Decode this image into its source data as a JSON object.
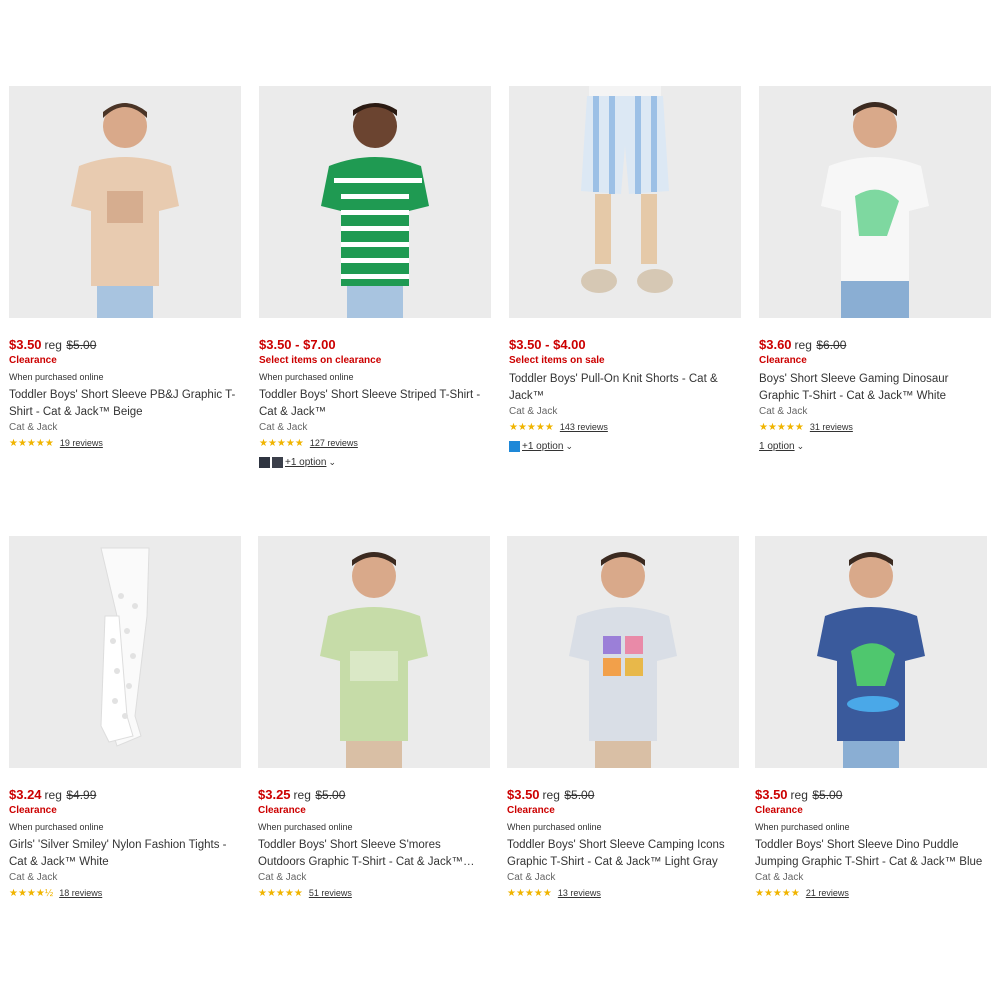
{
  "products": [
    {
      "price": "$3.50",
      "reg_label": "reg",
      "reg_price": "$5.00",
      "promo": "Clearance",
      "note": "When purchased online",
      "title": "Toddler Boys' Short Sleeve PB&J Graphic T-Shirt - Cat & Jack™ Beige",
      "brand": "Cat & Jack",
      "stars": "★★★★★",
      "reviews": "19 reviews",
      "shirt_color": "#e8cbb0",
      "bottom_color": "#a8c4e0"
    },
    {
      "price": "$3.50 - $7.00",
      "reg_label": "",
      "reg_price": "",
      "promo": "Select items on clearance",
      "note": "When purchased online",
      "title": "Toddler Boys' Short Sleeve Striped T-Shirt - Cat & Jack™",
      "brand": "Cat & Jack",
      "stars": "★★★★★",
      "reviews": "127 reviews",
      "option_label": "+1 option",
      "swatches": [
        "#2e3440",
        "#3b3f4a"
      ],
      "shirt_color": "#1f9a52",
      "bottom_color": "#a8c4e0"
    },
    {
      "price": "$3.50 - $4.00",
      "reg_label": "",
      "reg_price": "",
      "promo": "Select items on sale",
      "note": "",
      "title": "Toddler Boys' Pull-On Knit Shorts - Cat & Jack™",
      "brand": "Cat & Jack",
      "stars": "★★★★★",
      "reviews": "143 reviews",
      "option_label": "+1 option",
      "swatches": [
        "#1e88d8"
      ],
      "shirt_color": "#ffffff",
      "bottom_color": "#b8d2ec"
    },
    {
      "price": "$3.60",
      "reg_label": "reg",
      "reg_price": "$6.00",
      "promo": "Clearance",
      "note": "",
      "title": "Boys' Short Sleeve Gaming Dinosaur Graphic T-Shirt - Cat & Jack™ White",
      "brand": "Cat & Jack",
      "stars": "★★★★★",
      "reviews": "31 reviews",
      "option_label": "1 option",
      "shirt_color": "#f7f7f7",
      "bottom_color": "#8aaed3"
    },
    {
      "price": "$3.24",
      "reg_label": "reg",
      "reg_price": "$4.99",
      "promo": "Clearance",
      "note": "When purchased online",
      "title": "Girls' 'Silver Smiley' Nylon Fashion Tights - Cat & Jack™ White",
      "brand": "Cat & Jack",
      "stars": "★★★★½",
      "reviews": "18 reviews",
      "shirt_color": "#ffffff",
      "bottom_color": "#ffffff"
    },
    {
      "price": "$3.25",
      "reg_label": "reg",
      "reg_price": "$5.00",
      "promo": "Clearance",
      "note": "When purchased online",
      "title": "Toddler Boys' Short Sleeve S'mores Outdoors Graphic T-Shirt - Cat & Jack™…",
      "brand": "Cat & Jack",
      "stars": "★★★★★",
      "reviews": "51 reviews",
      "shirt_color": "#c6dca8",
      "bottom_color": "#d9bfa5"
    },
    {
      "price": "$3.50",
      "reg_label": "reg",
      "reg_price": "$5.00",
      "promo": "Clearance",
      "note": "When purchased online",
      "title": "Toddler Boys' Short Sleeve Camping Icons Graphic T-Shirt - Cat & Jack™ Light Gray",
      "brand": "Cat & Jack",
      "stars": "★★★★★",
      "reviews": "13 reviews",
      "shirt_color": "#d9dee6",
      "bottom_color": "#d9bfa5"
    },
    {
      "price": "$3.50",
      "reg_label": "reg",
      "reg_price": "$5.00",
      "promo": "Clearance",
      "note": "When purchased online",
      "title": "Toddler Boys' Short Sleeve Dino Puddle Jumping Graphic T-Shirt - Cat & Jack™ Blue",
      "brand": "Cat & Jack",
      "stars": "★★★★★",
      "reviews": "21 reviews",
      "shirt_color": "#3a5a9c",
      "bottom_color": "#8aaed3"
    }
  ]
}
